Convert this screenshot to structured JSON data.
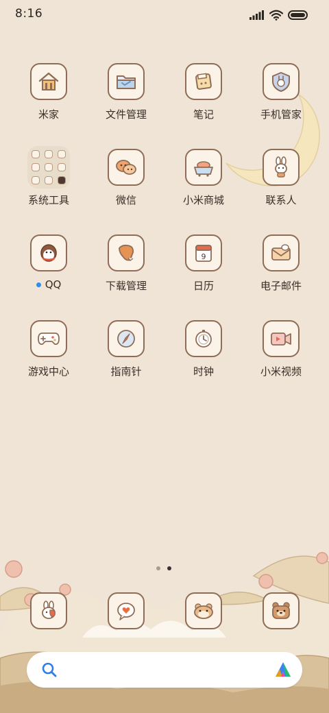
{
  "status_bar": {
    "time": "8:16",
    "signal_icon": "signal-bars-icon",
    "wifi_icon": "wifi-icon",
    "battery_icon": "battery-icon"
  },
  "apps": [
    {
      "name": "mijia",
      "label": "米家",
      "icon": "home-icon"
    },
    {
      "name": "file-manager",
      "label": "文件管理",
      "icon": "folder-icon"
    },
    {
      "name": "notes",
      "label": "笔记",
      "icon": "notes-icon"
    },
    {
      "name": "security",
      "label": "手机管家",
      "icon": "shield-icon"
    },
    {
      "name": "system-tools",
      "label": "系统工具",
      "icon": "folder-group-icon"
    },
    {
      "name": "wechat",
      "label": "微信",
      "icon": "chat-bubbles-icon"
    },
    {
      "name": "mi-store",
      "label": "小米商城",
      "icon": "store-icon"
    },
    {
      "name": "contacts",
      "label": "联系人",
      "icon": "bunny-contact-icon"
    },
    {
      "name": "qq",
      "label": "QQ",
      "icon": "penguin-icon",
      "has_new_dot": true
    },
    {
      "name": "downloads",
      "label": "下载管理",
      "icon": "download-icon"
    },
    {
      "name": "calendar",
      "label": "日历",
      "icon": "calendar-icon",
      "calendar_day": "9"
    },
    {
      "name": "email",
      "label": "电子邮件",
      "icon": "mail-icon"
    },
    {
      "name": "game-center",
      "label": "游戏中心",
      "icon": "gamepad-icon"
    },
    {
      "name": "compass",
      "label": "指南针",
      "icon": "compass-icon"
    },
    {
      "name": "clock",
      "label": "时钟",
      "icon": "clock-icon"
    },
    {
      "name": "mi-video",
      "label": "小米视频",
      "icon": "video-icon"
    }
  ],
  "page_indicator": {
    "pages": 2,
    "current": 2
  },
  "dock": [
    {
      "name": "phone",
      "icon": "bunny-phone-icon"
    },
    {
      "name": "messages",
      "icon": "heart-message-icon"
    },
    {
      "name": "browser",
      "icon": "hamster-icon"
    },
    {
      "name": "camera",
      "icon": "bear-camera-icon"
    }
  ],
  "search_bar": {
    "left_icon": "search-icon",
    "right_icon": "assistant-logo-icon"
  },
  "colors": {
    "background": "#efe4d6",
    "icon_tile": "#fbf3e7",
    "icon_border": "#8e6c56",
    "moon": "#f5e6bd",
    "accent_blue": "#2f8cf0"
  }
}
